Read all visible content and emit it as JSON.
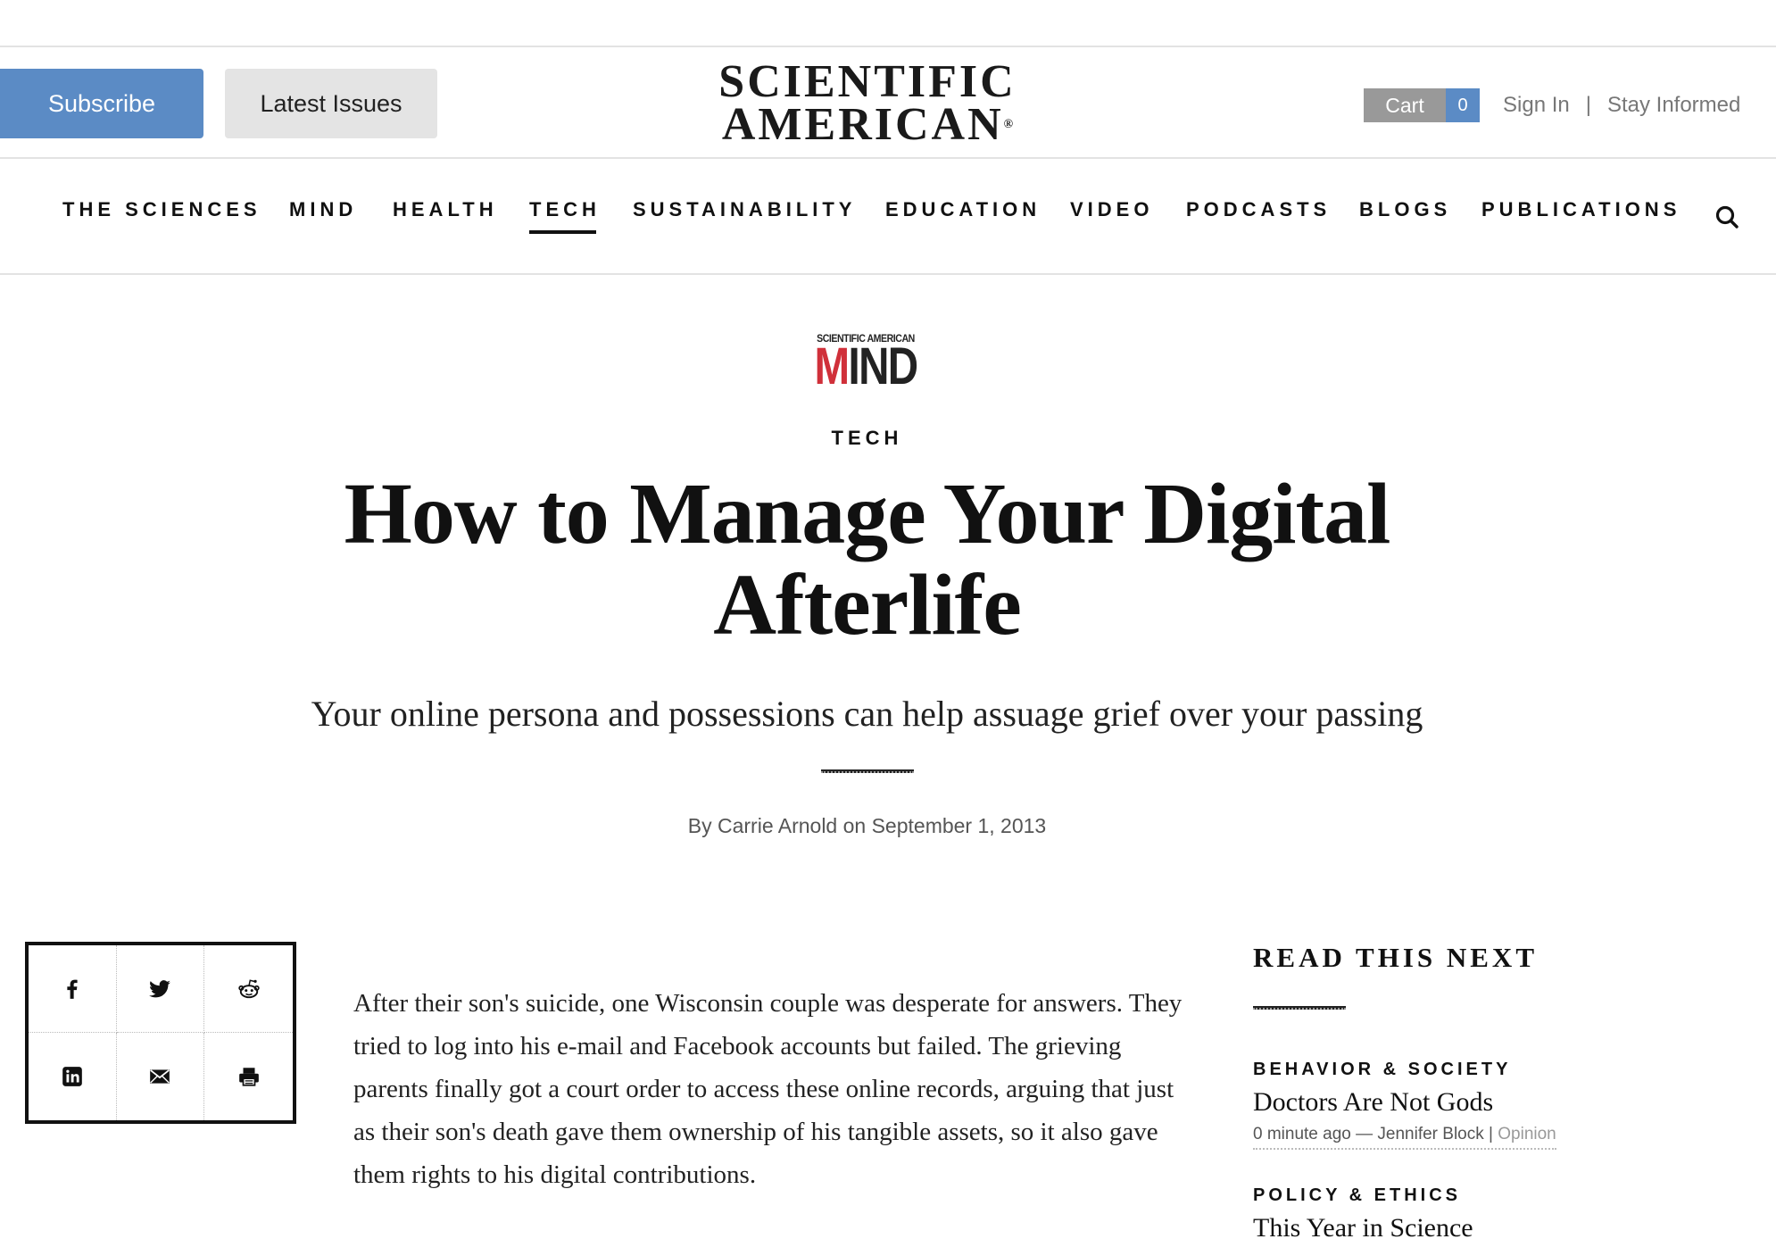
{
  "header": {
    "subscribe_label": "Subscribe",
    "latest_issues_label": "Latest Issues",
    "logo_line1": "SCIENTIFIC",
    "logo_line2": "AMERICAN",
    "logo_registered": "®",
    "cart_label": "Cart",
    "cart_count": "0",
    "sign_in_label": "Sign In",
    "separator": "|",
    "stay_informed_label": "Stay Informed"
  },
  "nav": {
    "items": [
      {
        "label": "THE SCIENCES"
      },
      {
        "label": "MIND"
      },
      {
        "label": "HEALTH"
      },
      {
        "label": "TECH"
      },
      {
        "label": "SUSTAINABILITY"
      },
      {
        "label": "EDUCATION"
      },
      {
        "label": "VIDEO"
      },
      {
        "label": "PODCASTS"
      },
      {
        "label": "BLOGS"
      },
      {
        "label": "PUBLICATIONS"
      }
    ],
    "active": "TECH",
    "search_icon": "search-icon"
  },
  "article": {
    "publication_logo_top": "SCIENTIFIC AMERICAN",
    "publication_logo_m": "M",
    "publication_logo_rest": "IND",
    "kicker": "TECH",
    "title": "How to Manage Your Digital Afterlife",
    "dek": "Your online persona and possessions can help assuage grief over your passing",
    "byline": "By Carrie Arnold on September 1, 2013",
    "body": "After their son's suicide, one Wisconsin couple was desperate for answers. They tried to log into his e-mail and Facebook accounts but failed. The grieving parents finally got a court order to access these online records, arguing that just as their son's death gave them ownership of his tangible assets, so it also gave them rights to his digital contributions."
  },
  "share": {
    "icons": [
      "facebook-icon",
      "twitter-icon",
      "reddit-icon",
      "linkedin-icon",
      "email-icon",
      "print-icon"
    ]
  },
  "sidebar": {
    "heading": "READ THIS NEXT",
    "stories": [
      {
        "category": "BEHAVIOR & SOCIETY",
        "title": "Doctors Are Not Gods",
        "meta": "0 minute ago — Jennifer Block",
        "meta_sep": "|",
        "meta_tag": "Opinion"
      },
      {
        "category": "POLICY & ETHICS",
        "title": "This Year in Science"
      }
    ]
  },
  "colors": {
    "subscribe_bg": "#5b8bc5",
    "latest_bg": "#e4e4e4",
    "cart_bg": "#999999",
    "cart_count_bg": "#5b8bc5",
    "mind_red": "#d0303a"
  }
}
